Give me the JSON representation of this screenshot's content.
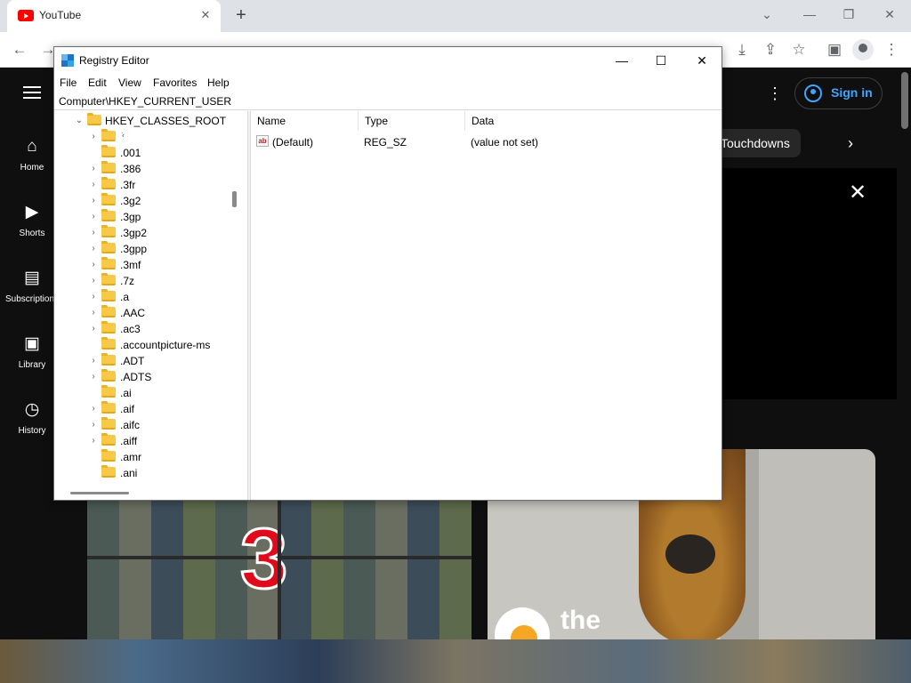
{
  "browser": {
    "tab_title": "YouTube",
    "tab_close": "✕",
    "new_tab": "+",
    "minimize": "⌄",
    "min": "—",
    "restore": "❐",
    "close": "✕",
    "back": "←",
    "forward": "→",
    "reload": "↻",
    "menu": "⋮"
  },
  "youtube": {
    "nav": [
      {
        "label": "Home",
        "icon": "home-icon"
      },
      {
        "label": "Shorts",
        "icon": "shorts-icon"
      },
      {
        "label": "Subscriptions",
        "icon": "subscriptions-icon"
      },
      {
        "label": "Library",
        "icon": "library-icon"
      },
      {
        "label": "History",
        "icon": "history-icon"
      }
    ],
    "sign_in": "Sign in",
    "chip": "Touchdowns",
    "chip_next": "›",
    "banner_close": "✕",
    "kebab": "⋮",
    "game_number": "3",
    "thumb_logo_text": "the"
  },
  "regedit": {
    "title": "Registry Editor",
    "minimize": "—",
    "maximize": "☐",
    "close": "✕",
    "menu": [
      "File",
      "Edit",
      "View",
      "Favorites",
      "Help"
    ],
    "address": "Computer\\HKEY_CURRENT_USER",
    "tree_root": "HKEY_CLASSES_ROOT",
    "tree_items": [
      {
        "label": "*",
        "expandable": true
      },
      {
        "label": ".001",
        "expandable": false
      },
      {
        "label": ".386",
        "expandable": true
      },
      {
        "label": ".3fr",
        "expandable": true
      },
      {
        "label": ".3g2",
        "expandable": true
      },
      {
        "label": ".3gp",
        "expandable": true
      },
      {
        "label": ".3gp2",
        "expandable": true
      },
      {
        "label": ".3gpp",
        "expandable": true
      },
      {
        "label": ".3mf",
        "expandable": true
      },
      {
        "label": ".7z",
        "expandable": true
      },
      {
        "label": ".a",
        "expandable": true
      },
      {
        "label": ".AAC",
        "expandable": true
      },
      {
        "label": ".ac3",
        "expandable": true
      },
      {
        "label": ".accountpicture-ms",
        "expandable": false
      },
      {
        "label": ".ADT",
        "expandable": true
      },
      {
        "label": ".ADTS",
        "expandable": true
      },
      {
        "label": ".ai",
        "expandable": false
      },
      {
        "label": ".aif",
        "expandable": true
      },
      {
        "label": ".aifc",
        "expandable": true
      },
      {
        "label": ".aiff",
        "expandable": true
      },
      {
        "label": ".amr",
        "expandable": false
      },
      {
        "label": ".ani",
        "expandable": false
      }
    ],
    "columns": [
      "Name",
      "Type",
      "Data"
    ],
    "values": [
      {
        "name": "(Default)",
        "type": "REG_SZ",
        "data": "(value not set)"
      }
    ],
    "ab_icon_text": "ab"
  }
}
